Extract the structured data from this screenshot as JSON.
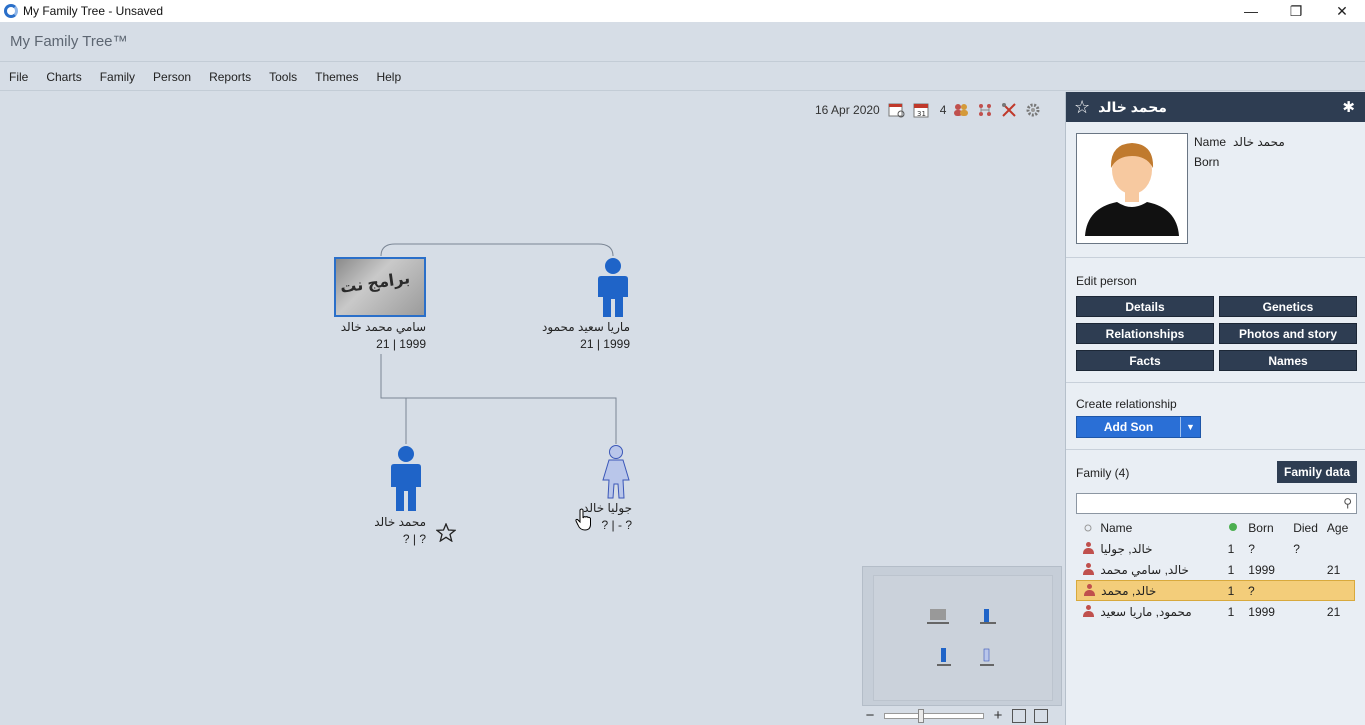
{
  "window": {
    "title": "My Family Tree - Unsaved",
    "minimize": "—",
    "restore": "❐",
    "close": "✕"
  },
  "app": {
    "brand": "My Family Tree™"
  },
  "menu": [
    "File",
    "Charts",
    "Family",
    "Person",
    "Reports",
    "Tools",
    "Themes",
    "Help"
  ],
  "toolbar": {
    "date": "16 Apr 2020",
    "count": "4"
  },
  "tree": {
    "people": [
      {
        "name": "سامي محمد خالد",
        "years": "21 | 1999",
        "photo_text": "برامج نت"
      },
      {
        "name": "ماريا سعيد محمود",
        "years": "21 | 1999"
      },
      {
        "name": "محمد خالد",
        "years": "? | ?"
      },
      {
        "name": "جوليا خالد",
        "years": "? | - ?"
      }
    ]
  },
  "panel": {
    "person_name": "محمد خالد",
    "name_label": "Name",
    "name_value": "محمد خالد",
    "born_label": "Born",
    "edit_title": "Edit person",
    "buttons": {
      "details": "Details",
      "genetics": "Genetics",
      "relationships": "Relationships",
      "photos": "Photos and story",
      "facts": "Facts",
      "names": "Names"
    },
    "create_title": "Create relationship",
    "add_son": "Add Son",
    "family_title": "Family (4)",
    "family_data": "Family data",
    "table": {
      "headers": {
        "name": "Name",
        "born": "Born",
        "died": "Died",
        "age": "Age"
      },
      "rows": [
        {
          "name": "خالد, جوليا",
          "gen": "1",
          "born": "?",
          "died": "?",
          "age": "",
          "color": "#c0504d"
        },
        {
          "name": "خالد, سامي محمد",
          "gen": "1",
          "born": "1999",
          "died": "",
          "age": "21",
          "color": "#c0504d"
        },
        {
          "name": "خالد, محمد",
          "gen": "1",
          "born": "?",
          "died": "",
          "age": "",
          "color": "#c0504d"
        },
        {
          "name": "محمود, ماريا سعيد",
          "gen": "1",
          "born": "1999",
          "died": "",
          "age": "21",
          "color": "#c0504d"
        }
      ]
    }
  }
}
